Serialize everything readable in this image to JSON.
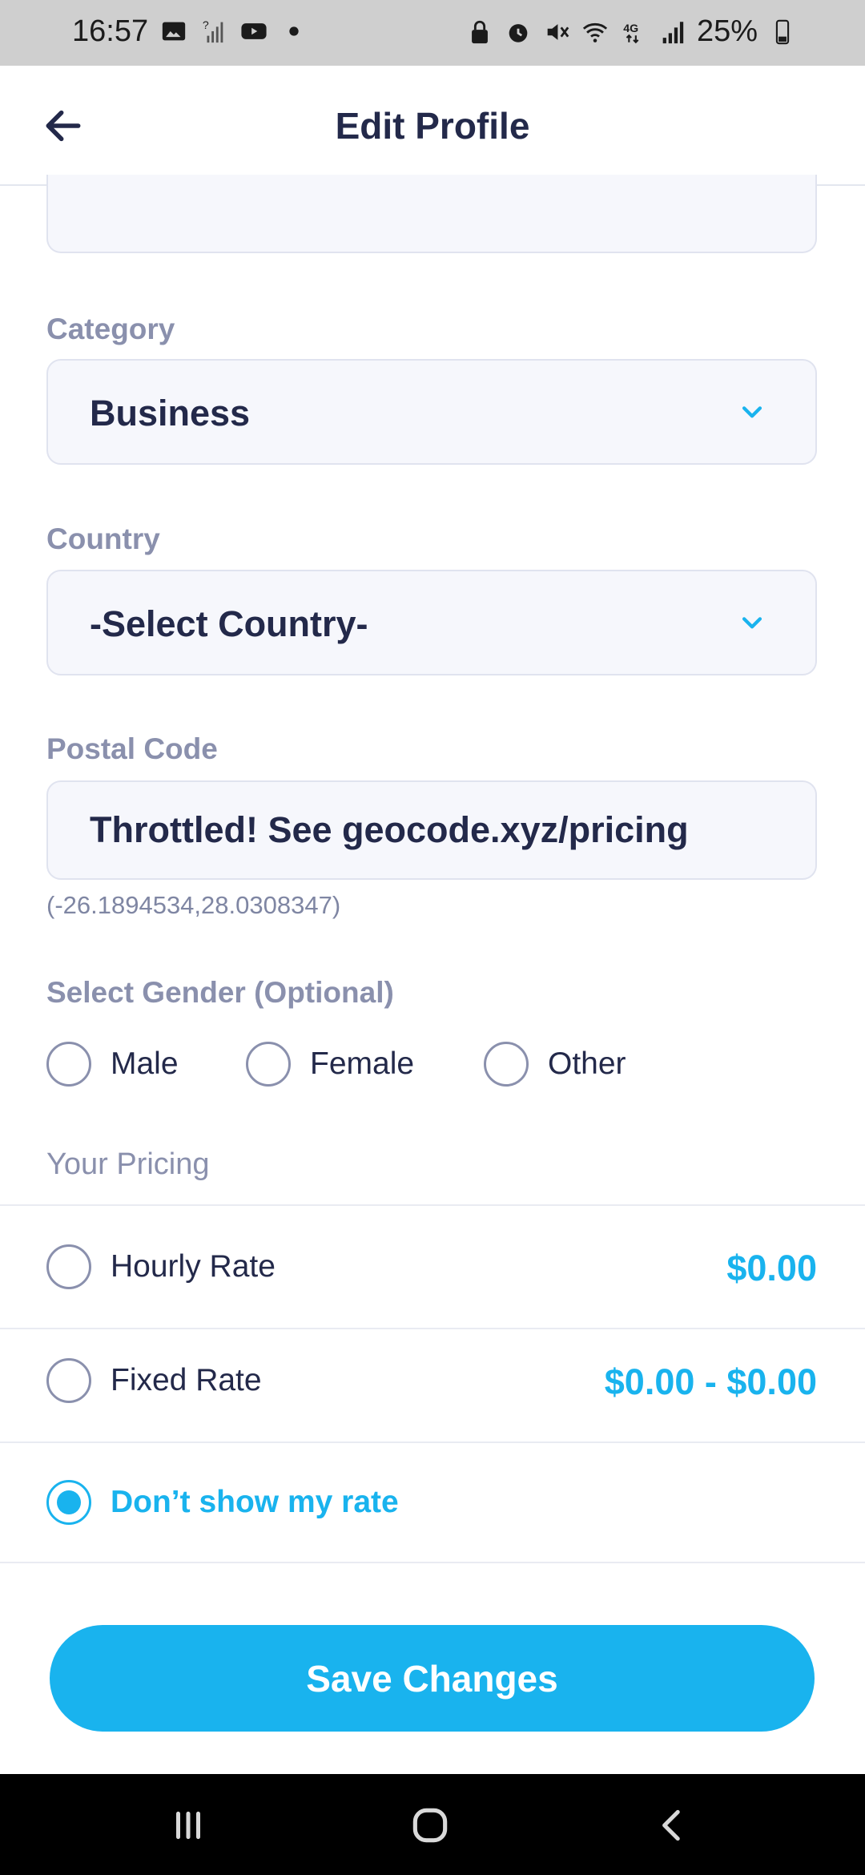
{
  "status_bar": {
    "time": "16:57",
    "battery": "25%",
    "icons_left": [
      "image-icon",
      "signal-question-icon",
      "youtube-icon",
      "dot-icon"
    ],
    "icons_right": [
      "lock-icon",
      "alarm-icon",
      "mute-icon",
      "wifi-icon",
      "4g-icon",
      "signal-icon",
      "battery-icon"
    ]
  },
  "app_bar": {
    "title": "Edit Profile",
    "back_icon": "arrow-left-icon"
  },
  "form": {
    "category": {
      "label": "Category",
      "value": "Business"
    },
    "country": {
      "label": "Country",
      "value": "-Select Country-"
    },
    "postal_code": {
      "label": "Postal Code",
      "value": "Throttled! See geocode.xyz/pricing",
      "coordinates": "(-26.1894534,28.0308347)"
    },
    "gender": {
      "label": "Select Gender (Optional)",
      "options": [
        "Male",
        "Female",
        "Other"
      ]
    }
  },
  "pricing": {
    "label": "Your Pricing",
    "options": [
      {
        "label": "Hourly Rate",
        "value": "$0.00",
        "selected": false
      },
      {
        "label": "Fixed Rate",
        "value": "$0.00 - $0.00",
        "selected": false
      },
      {
        "label": "Don’t show my rate",
        "selected": true
      }
    ]
  },
  "actions": {
    "save_label": "Save Changes"
  },
  "colors": {
    "accent": "#19b3ee",
    "text": "#23294a",
    "muted": "#8a90ad",
    "field_bg": "#f6f7fc"
  }
}
